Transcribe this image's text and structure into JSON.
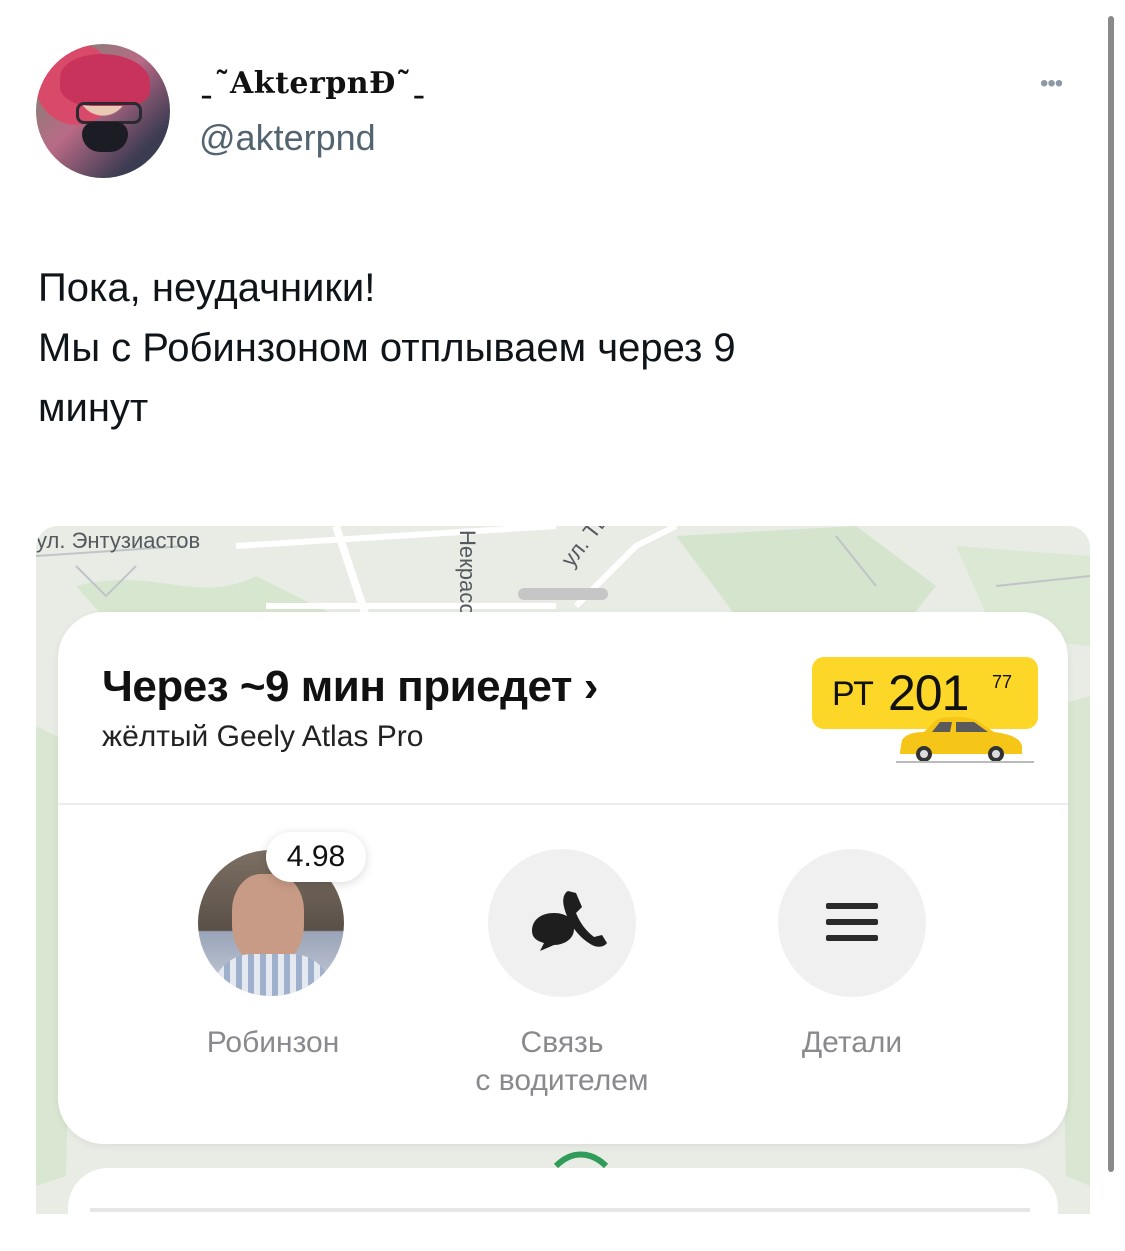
{
  "tweet": {
    "display_name": "ˍ˜AkterpnĐ˜ˍ",
    "handle": "@akterpnd",
    "more_label": "•••",
    "text_lines": [
      "Пока, неудачники!",
      "Мы с Робинзоном отплываем через 9",
      "минут"
    ]
  },
  "map": {
    "labels": [
      "ул. Энтузиастов",
      "Некрасо",
      "ул. Твардов"
    ]
  },
  "ride": {
    "eta": "Через ~9 мин приедет",
    "chevron": "›",
    "car": "жёлтый Geely Atlas Pro",
    "plate": {
      "letters": "РТ",
      "number": "201",
      "region": "77"
    },
    "colors": {
      "plate": "#fcd727",
      "car": "#f5c518"
    }
  },
  "driver": {
    "name": "Робинзон",
    "rating": "4.98"
  },
  "actions": {
    "contact_line1": "Связь",
    "contact_line2": "с водителем",
    "details": "Детали"
  }
}
